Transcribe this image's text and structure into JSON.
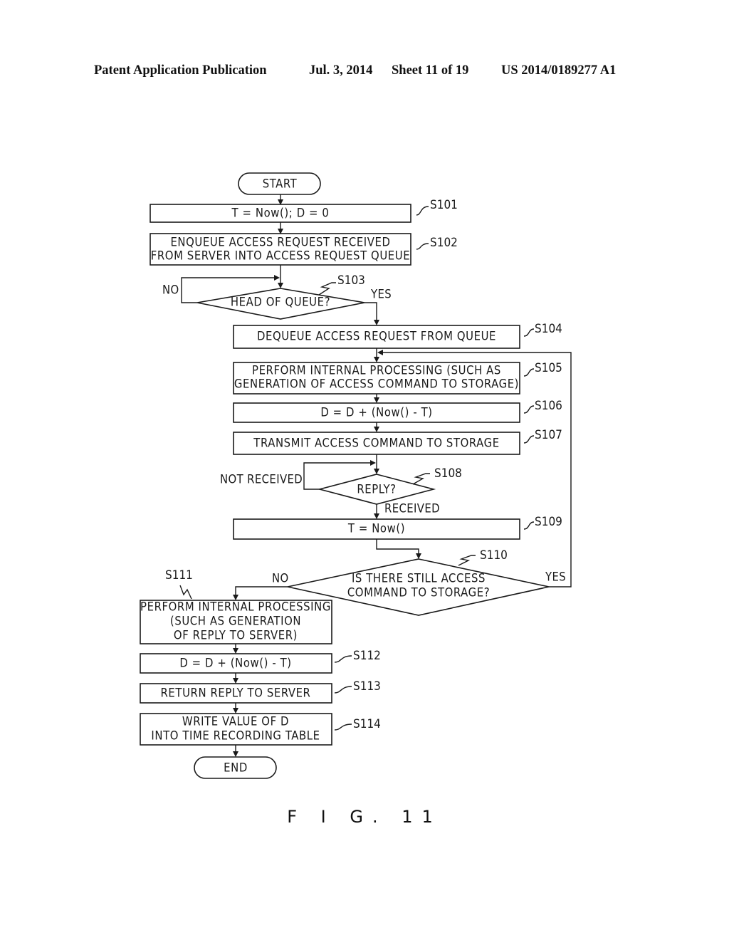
{
  "header": {
    "publication": "Patent Application Publication",
    "date": "Jul. 3, 2014",
    "sheet": "Sheet 11 of 19",
    "number": "US 2014/0189277 A1"
  },
  "flowchart": {
    "start": "START",
    "end": "END",
    "steps": {
      "s101": {
        "id": "S101",
        "lines": [
          "T = Now(); D = 0"
        ]
      },
      "s102": {
        "id": "S102",
        "lines": [
          "ENQUEUE ACCESS REQUEST RECEIVED",
          "FROM SERVER INTO ACCESS REQUEST QUEUE"
        ]
      },
      "s103": {
        "id": "S103",
        "lines": [
          "HEAD OF QUEUE?"
        ],
        "yes": "YES",
        "no": "NO"
      },
      "s104": {
        "id": "S104",
        "lines": [
          "DEQUEUE ACCESS REQUEST FROM QUEUE"
        ]
      },
      "s105": {
        "id": "S105",
        "lines": [
          "PERFORM INTERNAL PROCESSING (SUCH AS",
          "GENERATION OF ACCESS COMMAND TO STORAGE)"
        ]
      },
      "s106": {
        "id": "S106",
        "lines": [
          "D = D + (Now() - T)"
        ]
      },
      "s107": {
        "id": "S107",
        "lines": [
          "TRANSMIT ACCESS COMMAND TO STORAGE"
        ]
      },
      "s108": {
        "id": "S108",
        "lines": [
          "REPLY?"
        ],
        "yes": "RECEIVED",
        "no": "NOT RECEIVED"
      },
      "s109": {
        "id": "S109",
        "lines": [
          "T = Now()"
        ]
      },
      "s110": {
        "id": "S110",
        "lines": [
          "IS THERE STILL ACCESS",
          "COMMAND TO STORAGE?"
        ],
        "yes": "YES",
        "no": "NO"
      },
      "s111": {
        "id": "S111",
        "lines": [
          "PERFORM INTERNAL PROCESSING",
          "(SUCH AS GENERATION",
          "OF REPLY TO SERVER)"
        ]
      },
      "s112": {
        "id": "S112",
        "lines": [
          "D = D + (Now() - T)"
        ]
      },
      "s113": {
        "id": "S113",
        "lines": [
          "RETURN REPLY TO SERVER"
        ]
      },
      "s114": {
        "id": "S114",
        "lines": [
          "WRITE VALUE OF D",
          "INTO TIME RECORDING TABLE"
        ]
      }
    }
  },
  "figure_label": "F I G. 11"
}
